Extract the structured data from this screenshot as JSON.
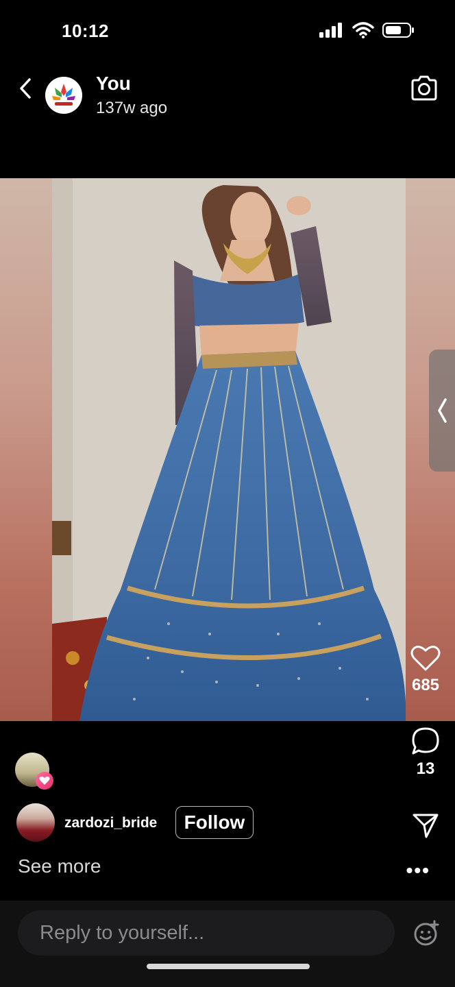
{
  "status_bar": {
    "time": "10:12",
    "icons": [
      "cellular-signal-icon",
      "wifi-icon",
      "battery-icon"
    ]
  },
  "header": {
    "name": "You",
    "time_ago": "137w ago",
    "back_icon": "chevron-left-icon",
    "camera_icon": "camera-icon"
  },
  "story": {
    "side_tab_icon": "chevron-left-icon"
  },
  "actions": {
    "likes": "685",
    "comments": "13",
    "like_icon": "heart-icon",
    "comment_icon": "comment-bubble-icon",
    "share_icon": "send-icon"
  },
  "creator": {
    "username": "zardozi_bride",
    "follow_label": "Follow"
  },
  "footer": {
    "see_more": "See more",
    "more_icon": "more-horizontal-icon"
  },
  "reply": {
    "placeholder": "Reply to yourself..."
  },
  "colors": {
    "background": "#000000",
    "reply_bg": "#1c1c1e",
    "skirt_blue": "#3f6ea7",
    "heart_badge": "#ff4f88"
  }
}
